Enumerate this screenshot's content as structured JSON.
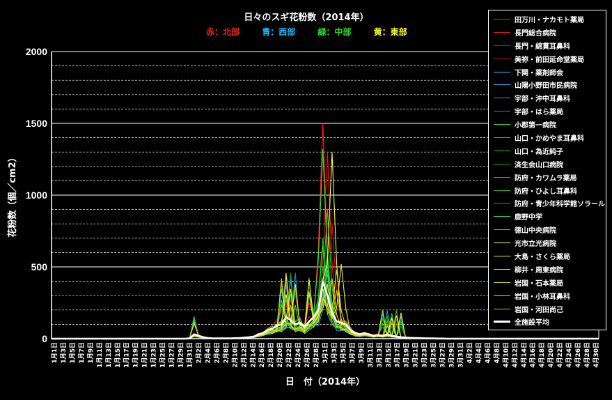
{
  "chart_data": {
    "type": "line",
    "title": "日々のスギ花粉数（2014年）",
    "region_legend": [
      {
        "label": "赤：北部",
        "color": "#ff2020"
      },
      {
        "label": "青：西部",
        "color": "#20b8ff"
      },
      {
        "label": "緑：中部",
        "color": "#20e020"
      },
      {
        "label": "黄：東部",
        "color": "#ffff20"
      }
    ],
    "xlabel": "日　付（2014年）",
    "ylabel": "花粉数（個／cm2）",
    "ylim": [
      0,
      2000
    ],
    "y_major_ticks": [
      0,
      500,
      1000,
      1500,
      2000
    ],
    "y_minor_step": 100,
    "grid": true,
    "legend_placement": "right",
    "x_tick_labels": [
      "1月1日",
      "1月3日",
      "1月5日",
      "1月7日",
      "1月9日",
      "1月11日",
      "1月13日",
      "1月15日",
      "1月17日",
      "1月19日",
      "1月21日",
      "1月23日",
      "1月25日",
      "1月27日",
      "1月29日",
      "1月31日",
      "2月2日",
      "2月4日",
      "2月6日",
      "2月8日",
      "2月10日",
      "2月12日",
      "2月14日",
      "2月16日",
      "2月18日",
      "2月20日",
      "2月22日",
      "2月24日",
      "2月26日",
      "2月28日",
      "3月1日",
      "3月3日",
      "3月5日",
      "3月7日",
      "3月9日",
      "3月11日",
      "3月13日",
      "3月15日",
      "3月17日",
      "3月19日",
      "3月21日",
      "3月23日",
      "3月25日",
      "3月27日",
      "3月29日",
      "3月31日",
      "4月2日",
      "4月4日",
      "4月6日",
      "4月8日",
      "4月10日",
      "4月12日",
      "4月14日",
      "4月16日",
      "4月18日",
      "4月20日",
      "4月22日",
      "4月24日",
      "4月26日",
      "4月28日",
      "4月30日"
    ],
    "series": [
      {
        "name": "田万川・ナカモト薬局",
        "color": "#ff2020",
        "peak_day": 59,
        "peak": 1500,
        "scale": 1.0
      },
      {
        "name": "長門総合病院",
        "color": "#e81818",
        "peak_day": 60,
        "peak": 1300,
        "scale": 0.95
      },
      {
        "name": "長門・綿貫耳鼻科",
        "color": "#dd1010",
        "peak_day": 61,
        "peak": 800,
        "scale": 0.8
      },
      {
        "name": "美祢・前田延命堂薬局",
        "color": "#cc1010",
        "peak_day": 51,
        "peak": 460,
        "scale": 0.7
      },
      {
        "name": "下関・薬剤師会",
        "color": "#30c8ff",
        "peak_day": 60,
        "peak": 520,
        "scale": 0.6
      },
      {
        "name": "山陽小野田市民病院",
        "color": "#20b0f0",
        "peak_day": 60,
        "peak": 450,
        "scale": 0.55
      },
      {
        "name": "宇部・沖中耳鼻科",
        "color": "#18a0e8",
        "peak_day": 59,
        "peak": 420,
        "scale": 0.5
      },
      {
        "name": "宇部・はら薬局",
        "color": "#1090d8",
        "peak_day": 60,
        "peak": 380,
        "scale": 0.5
      },
      {
        "name": "小郡第一病院",
        "color": "#30e030",
        "peak_day": 59,
        "peak": 1320,
        "scale": 0.9
      },
      {
        "name": "山口・かめやま耳鼻科",
        "color": "#20d020",
        "peak_day": 60,
        "peak": 900,
        "scale": 0.8
      },
      {
        "name": "山口・為近純子",
        "color": "#18c018",
        "peak_day": 59,
        "peak": 700,
        "scale": 0.75
      },
      {
        "name": "済生会山口病院",
        "color": "#10b010",
        "peak_day": 60,
        "peak": 600,
        "scale": 0.7
      },
      {
        "name": "防府・カワムラ薬局",
        "color": "#28c828",
        "peak_day": 59,
        "peak": 650,
        "scale": 0.7
      },
      {
        "name": "防府・ひよし耳鼻科",
        "color": "#20b820",
        "peak_day": 60,
        "peak": 560,
        "scale": 0.65
      },
      {
        "name": "防府・青少年科学館ソラール",
        "color": "#18a818",
        "peak_day": 59,
        "peak": 500,
        "scale": 0.6
      },
      {
        "name": "鹿野中学",
        "color": "#40e040",
        "peak_day": 60,
        "peak": 480,
        "scale": 0.6
      },
      {
        "name": "徳山中央病院",
        "color": "#30d030",
        "peak_day": 59,
        "peak": 420,
        "scale": 0.55
      },
      {
        "name": "光市立光病院",
        "color": "#ffff30",
        "peak_day": 61,
        "peak": 1300,
        "scale": 0.85
      },
      {
        "name": "大島・さくら薬局",
        "color": "#f0f020",
        "peak_day": 63,
        "peak": 520,
        "scale": 0.7
      },
      {
        "name": "柳井・周東病院",
        "color": "#e8e818",
        "peak_day": 62,
        "peak": 480,
        "scale": 0.65
      },
      {
        "name": "岩国・石本薬局",
        "color": "#d8d810",
        "peak_day": 61,
        "peak": 420,
        "scale": 0.6
      },
      {
        "name": "岩国・小林耳鼻科",
        "color": "#e0e040",
        "peak_day": 60,
        "peak": 380,
        "scale": 0.55
      },
      {
        "name": "岩国・河田尚己",
        "color": "#c8c810",
        "peak_day": 62,
        "peak": 340,
        "scale": 0.5
      }
    ],
    "average": {
      "name": "全施設平均",
      "color": "#ffffff",
      "values": [
        0,
        0,
        0,
        0,
        0,
        0,
        0,
        0,
        0,
        0,
        0,
        0,
        0,
        0,
        0,
        0,
        0,
        0,
        0,
        0,
        0,
        0,
        0,
        0,
        0,
        0,
        0,
        0,
        0,
        0,
        2,
        30,
        20,
        10,
        5,
        2,
        2,
        2,
        2,
        2,
        4,
        5,
        8,
        10,
        15,
        30,
        40,
        60,
        70,
        90,
        100,
        150,
        130,
        100,
        110,
        80,
        120,
        150,
        200,
        400,
        300,
        180,
        120,
        110,
        100,
        60,
        40,
        30,
        40,
        30,
        20,
        25,
        20,
        30,
        20,
        15,
        10,
        8,
        6,
        5,
        4,
        3,
        2,
        2,
        1,
        1,
        0,
        0,
        0,
        0,
        0,
        0,
        0,
        0,
        0,
        0,
        0,
        0,
        0,
        0,
        0,
        0,
        0,
        0,
        0,
        0,
        0,
        0,
        0,
        0,
        0,
        0,
        0,
        0,
        0,
        0,
        0,
        0,
        0,
        0
      ]
    }
  }
}
